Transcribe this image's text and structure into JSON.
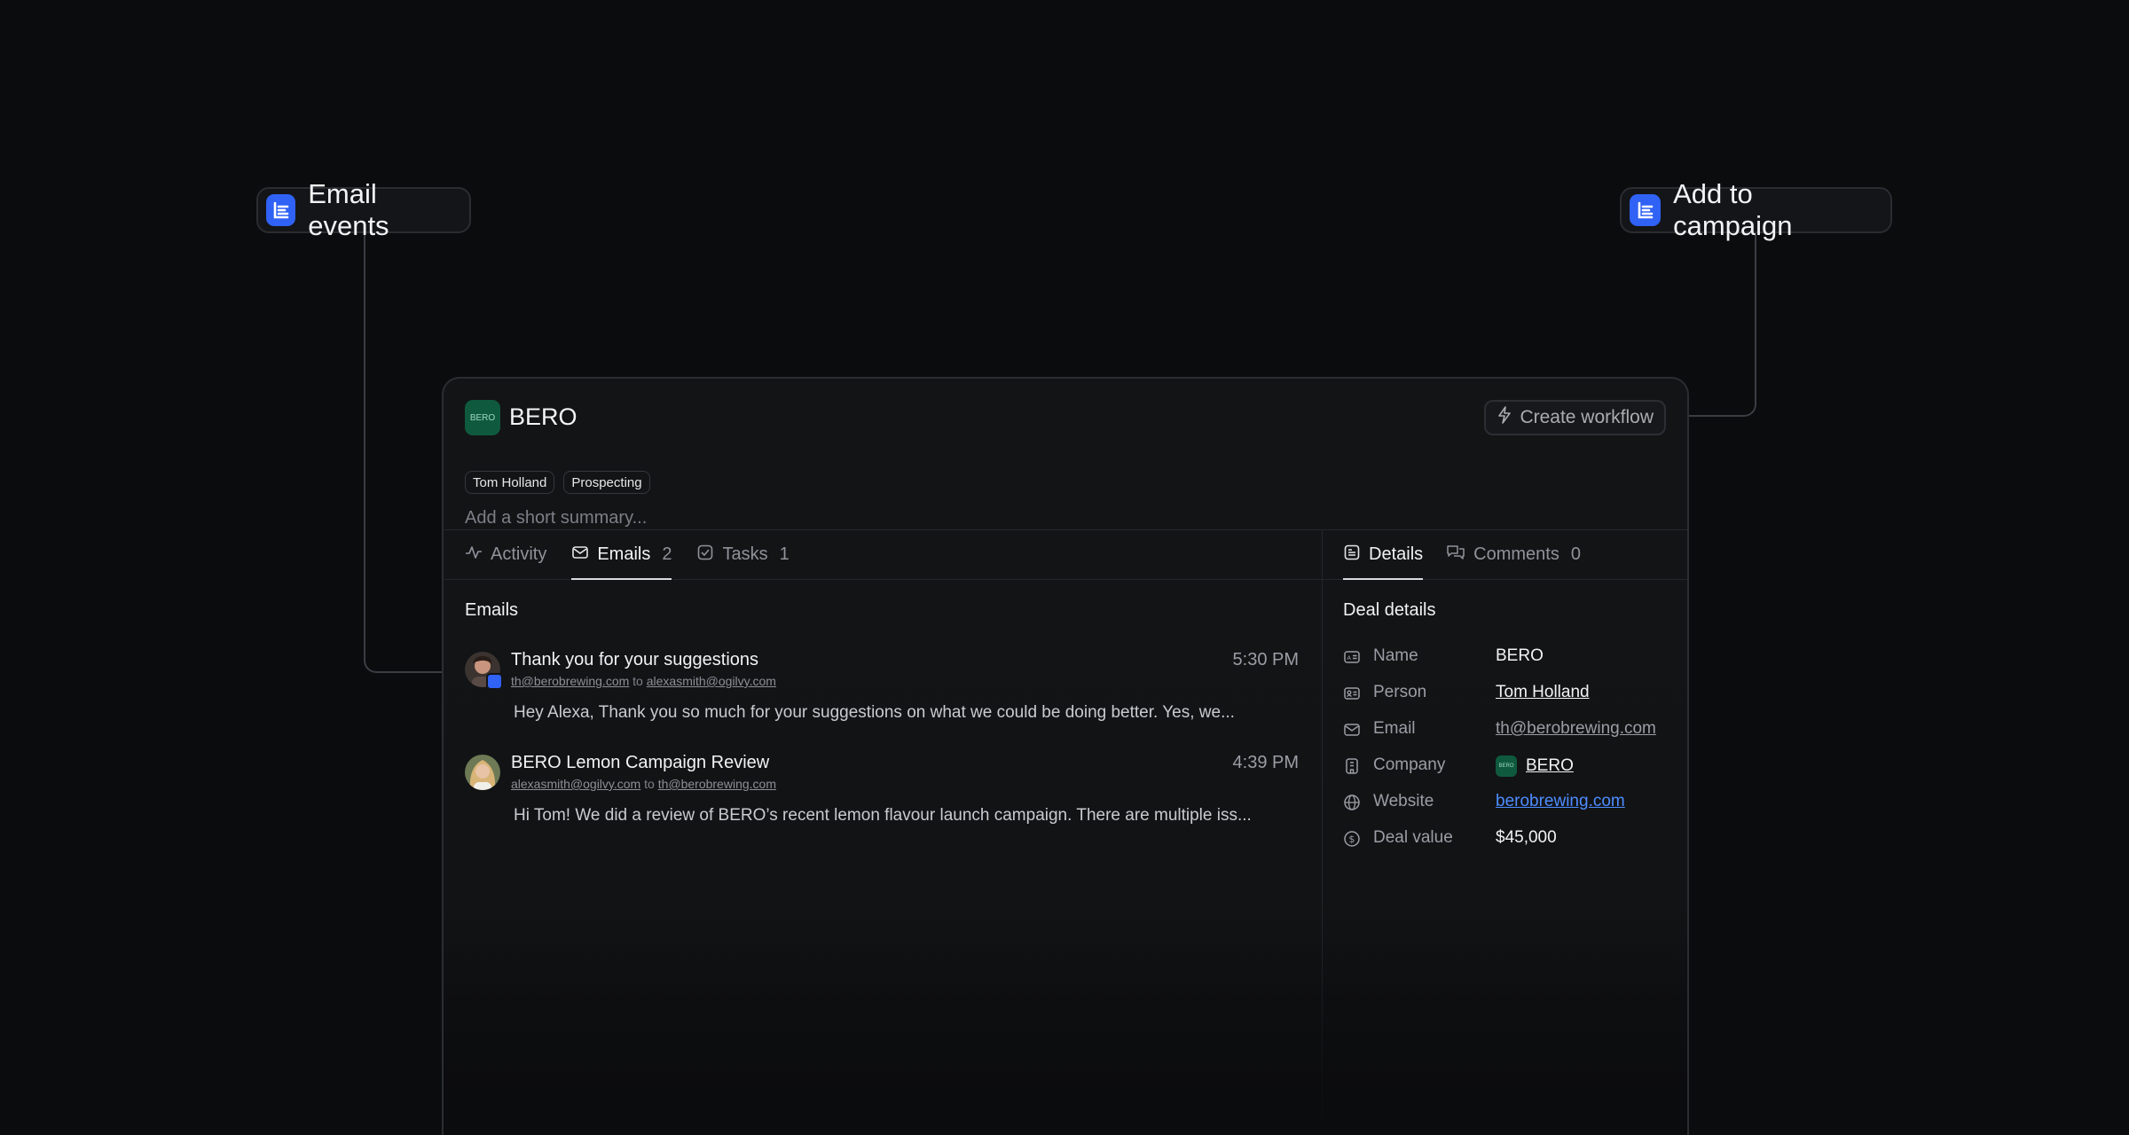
{
  "triggers": {
    "left": {
      "label": "Email events",
      "icon": "logo-e-icon"
    },
    "right": {
      "label": "Add to campaign",
      "icon": "logo-e-icon"
    }
  },
  "deal": {
    "logo_text": "BERO",
    "title": "BERO",
    "create_workflow_label": "Create workflow",
    "chips": [
      "Tom Holland",
      "Prospecting"
    ],
    "summary_placeholder": "Add a short summary..."
  },
  "tabs": [
    {
      "label": "Activity",
      "count": "",
      "icon": "activity-icon",
      "active": false
    },
    {
      "label": "Emails",
      "count": "2",
      "icon": "mail-icon",
      "active": true
    },
    {
      "label": "Tasks",
      "count": "1",
      "icon": "checkbox-icon",
      "active": false
    }
  ],
  "side_tabs": [
    {
      "label": "Details",
      "count": "",
      "icon": "details-icon",
      "active": true
    },
    {
      "label": "Comments",
      "count": "0",
      "icon": "comments-icon",
      "active": false
    }
  ],
  "emails": {
    "title": "Emails",
    "items": [
      {
        "subject": "Thank you for your suggestions",
        "time": "5:30 PM",
        "from": "th@berobrewing.com",
        "to_word": "to",
        "to": "alexasmith@ogilvy.com",
        "preview": "Hey Alexa, Thank you so much for your suggestions on what we could be doing better. Yes, we..."
      },
      {
        "subject": "BERO Lemon Campaign Review",
        "time": "4:39 PM",
        "from": "alexasmith@ogilvy.com",
        "to_word": "to",
        "to": "th@berobrewing.com",
        "preview": "Hi Tom! We did a review of BERO’s recent lemon flavour launch campaign. There are multiple iss..."
      }
    ]
  },
  "details": {
    "title": "Deal details",
    "rows": [
      {
        "label": "Name",
        "value": "BERO",
        "icon": "id-card-icon",
        "style": "plain"
      },
      {
        "label": "Person",
        "value": "Tom Holland",
        "icon": "person-card-icon",
        "style": "link-white"
      },
      {
        "label": "Email",
        "value": "th@berobrewing.com",
        "icon": "mail-icon",
        "style": "link-gray"
      },
      {
        "label": "Company",
        "value": "BERO",
        "icon": "building-icon",
        "style": "link-white"
      },
      {
        "label": "Website",
        "value": "berobrewing.com",
        "icon": "globe-icon",
        "style": "link-blue"
      },
      {
        "label": "Deal value",
        "value": "$45,000",
        "icon": "dollar-icon",
        "style": "plain"
      }
    ]
  },
  "colors": {
    "background": "#0b0c0e",
    "card": "#131416",
    "accent_blue": "#2f62f5",
    "bero_green": "#0f5a3e",
    "link_blue": "#4d8dff"
  }
}
